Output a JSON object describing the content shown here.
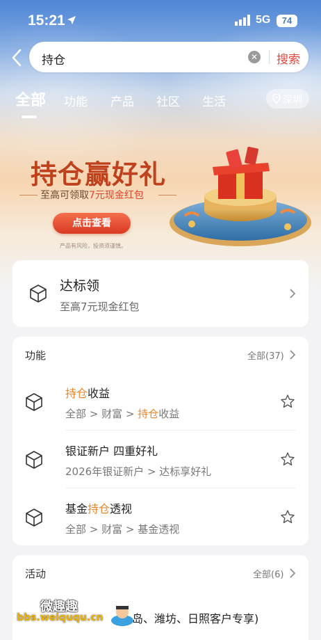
{
  "status_bar": {
    "time": "15:21",
    "network": "5G",
    "battery": "74"
  },
  "search": {
    "query": "持仓",
    "clear_icon": "close-circle-icon",
    "button_label": "搜索"
  },
  "tabs": [
    {
      "label": "全部",
      "active": true
    },
    {
      "label": "功能"
    },
    {
      "label": "产品"
    },
    {
      "label": "社区"
    },
    {
      "label": "生活"
    }
  ],
  "city": "深圳",
  "banner": {
    "title": "持仓赢好礼",
    "subtitle_prefix": "至高可领取",
    "subtitle_highlight": "7元现金红包",
    "button": "点击查看",
    "risk_note": "产品有风险，投资须谨慎。"
  },
  "promo_card": {
    "title": "达标领",
    "subtitle": "至高7元现金红包"
  },
  "functions_section": {
    "title": "功能",
    "all_label": "全部(37)",
    "items": [
      {
        "title_highlight": "持仓",
        "title_rest": "收益",
        "path_prefix": "全部 > 财富 > ",
        "path_highlight": "持仓",
        "path_rest": "收益"
      },
      {
        "title_plain": "银证新户 四重好礼",
        "path_plain": "2026年银证新户 > 达标享好礼"
      },
      {
        "title_prefix": "基金",
        "title_highlight": "持仓",
        "title_rest": "透视",
        "path_plain": "全部 > 财富 > 基金透视"
      }
    ]
  },
  "activities_section": {
    "title": "活动",
    "all_label": "全部(6)",
    "partial_row": "岛、潍坊、日照客户专享)"
  },
  "watermark": {
    "line1": "微趣趣",
    "line2": "bbs.weiququ.cn"
  },
  "colors": {
    "accent_red": "#e4473b",
    "highlight_orange": "#e8862e"
  }
}
